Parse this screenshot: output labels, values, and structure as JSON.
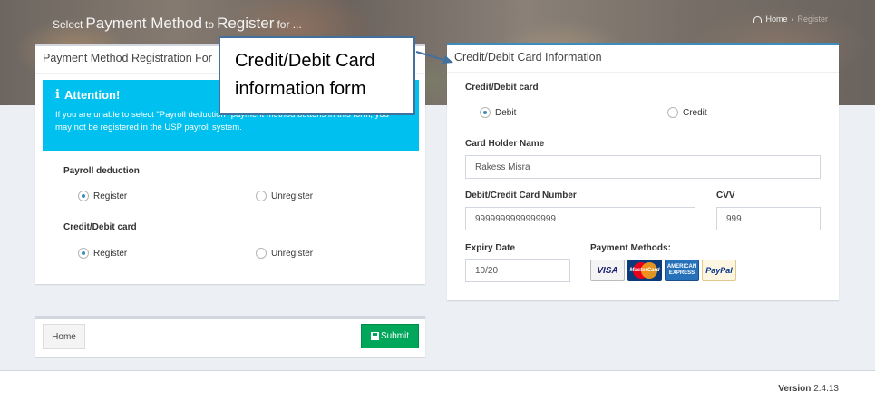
{
  "hero": {
    "title_select": "Select",
    "title_payment": "Payment Method",
    "title_to": "to",
    "title_register": "Register",
    "title_for": "for ..."
  },
  "breadcrumb": {
    "home": "Home",
    "current": "Register"
  },
  "left_panel": {
    "header": "Payment Method Registration For",
    "callout_title": "Attention!",
    "callout_text": "If you are unable to select \"Payroll deduction\" payment method buttons in this form, you may not be registered in the USP payroll system.",
    "payroll_label": "Payroll deduction",
    "payroll_options": [
      "Register",
      "Unregister"
    ],
    "payroll_selected": "Register",
    "card_label": "Credit/Debit card",
    "card_options": [
      "Register",
      "Unregister"
    ],
    "card_selected": "Register"
  },
  "right_panel": {
    "header": "Credit/Debit Card Information",
    "card_type_label": "Credit/Debit card",
    "card_type_options": [
      "Debit",
      "Credit"
    ],
    "card_type_selected": "Debit",
    "holder_label": "Card Holder Name",
    "holder_value": "Rakess Misra",
    "number_label": "Debit/Credit Card Number",
    "number_value": "9999999999999999",
    "cvv_label": "CVV",
    "cvv_value": "999",
    "expiry_label": "Expiry Date",
    "expiry_value": "10/20",
    "methods_label": "Payment Methods:",
    "methods": [
      "VISA",
      "MasterCard",
      "AMERICAN EXPRESS",
      "PayPal"
    ]
  },
  "footer_buttons": {
    "home": "Home",
    "submit": "Submit"
  },
  "main_footer": {
    "version_label": "Version",
    "version_number": "2.4.13"
  },
  "annotation": {
    "line1": "Credit/Debit Card",
    "line2": "information form"
  },
  "colors": {
    "callout": "#00c0ef",
    "submit": "#00a65a",
    "primary": "#3c8dbc",
    "annotation_border": "#41719c"
  }
}
